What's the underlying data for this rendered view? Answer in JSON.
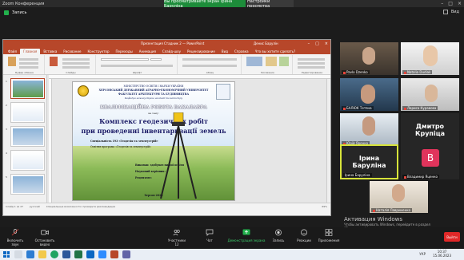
{
  "zoom": {
    "title": "Zoom Конференция",
    "sharing_banner": "Вы просматриваете экран Ірина Баруліна",
    "view_options": "Настройки просмотра",
    "sub_label": "Запись",
    "view_button": "Вид"
  },
  "ppt": {
    "doc_title": "Презентация Стадник 2 — PowerPoint",
    "user": "Денис Барулін",
    "tabs": [
      "Файл",
      "Главная",
      "Вставка",
      "Рисование",
      "Конструктор",
      "Переходы",
      "Анимация",
      "Слайд-шоу",
      "Рецензирование",
      "Вид",
      "Справка",
      "Что вы хотите сделать?"
    ],
    "active_tab": "Главная",
    "ribbon_groups": [
      "Буфер обмена",
      "Слайды",
      "Шрифт",
      "Абзац",
      "Рисование",
      "Редактирование"
    ],
    "status_left": "Слайд 1 из 27",
    "status_lang": "русский",
    "status_access": "Специальные возможности: проверьте рекомендации",
    "zoom_level": "69%",
    "thumb_numbers": [
      "1",
      "2",
      "3",
      "4",
      "5",
      "6"
    ]
  },
  "slide": {
    "ministry": "МІНІСТЕРСТВО ОСВІТИ І НАУКИ УКРАЇНИ",
    "university": "ХЕРСОНСЬКИЙ ДЕРЖАВНИЙ АГРАРНО-ЕКОНОМІЧНИЙ УНІВЕРСИТЕТ",
    "faculty": "ФАКУЛЬТЕТ АРХІТЕКТУРИ ТА БУДІВНИЦТВА",
    "department": "Кафедра землеустрою геодезії та кадастру",
    "work_type": "КВАЛІФІКАЦІЙНА РОБОТА БАКАЛАВРА",
    "on_topic": "на тему:",
    "title_line1": "Комплекс геодезичних робіт",
    "title_line2": "при проведенні інвентаризації земель",
    "specialty": "Спеціальність 193 «Геодезія та землеустрій»",
    "program": "Освітня програма «Геодезія та землеустрій»",
    "performed": "Виконав: здобувач вищої освіти",
    "supervisor": "Науковий керівник:",
    "reviewer": "Рецензент:",
    "city": "Херсон 2023"
  },
  "participants": [
    {
      "name": "Pavlo Dzenko"
    },
    {
      "name": "Natalia Dudiak"
    },
    {
      "name": "БАЛЮК Тетяна"
    },
    {
      "name": "Лариса Куравова"
    },
    {
      "name": "Юрій Яренко"
    },
    {
      "name": "Дмитро Крупіца",
      "big": "Дмитро Крупіца"
    },
    {
      "name": "Ірина Баруліна",
      "big": "Ірина Баруліна"
    },
    {
      "name": "Владимир Яценко",
      "initial": "B"
    },
    {
      "name": "Наталія Лавриненко"
    }
  ],
  "activation": {
    "title": "Активация Windows",
    "line1": "Чтобы активировать Windows, перейдите в раздел",
    "line2": "\"Параметры\"."
  },
  "toolbar": {
    "mic": "Включить звук",
    "video": "Остановить видео",
    "participants": "Участники",
    "participants_count": "12",
    "chat": "Чат",
    "share": "Демонстрация экрана",
    "record": "Запись",
    "reactions": "Реакции",
    "apps": "Приложения",
    "end": "Выйти"
  },
  "taskbar": {
    "time": "10:37",
    "date": "15.06.2023",
    "lang": "УКР"
  },
  "colors": {
    "ppt_accent": "#b7472a",
    "zoom_share_green": "#1d8c3a",
    "active_speaker_border": "#d7e33a",
    "initial_tile_pink": "#e0345c"
  }
}
